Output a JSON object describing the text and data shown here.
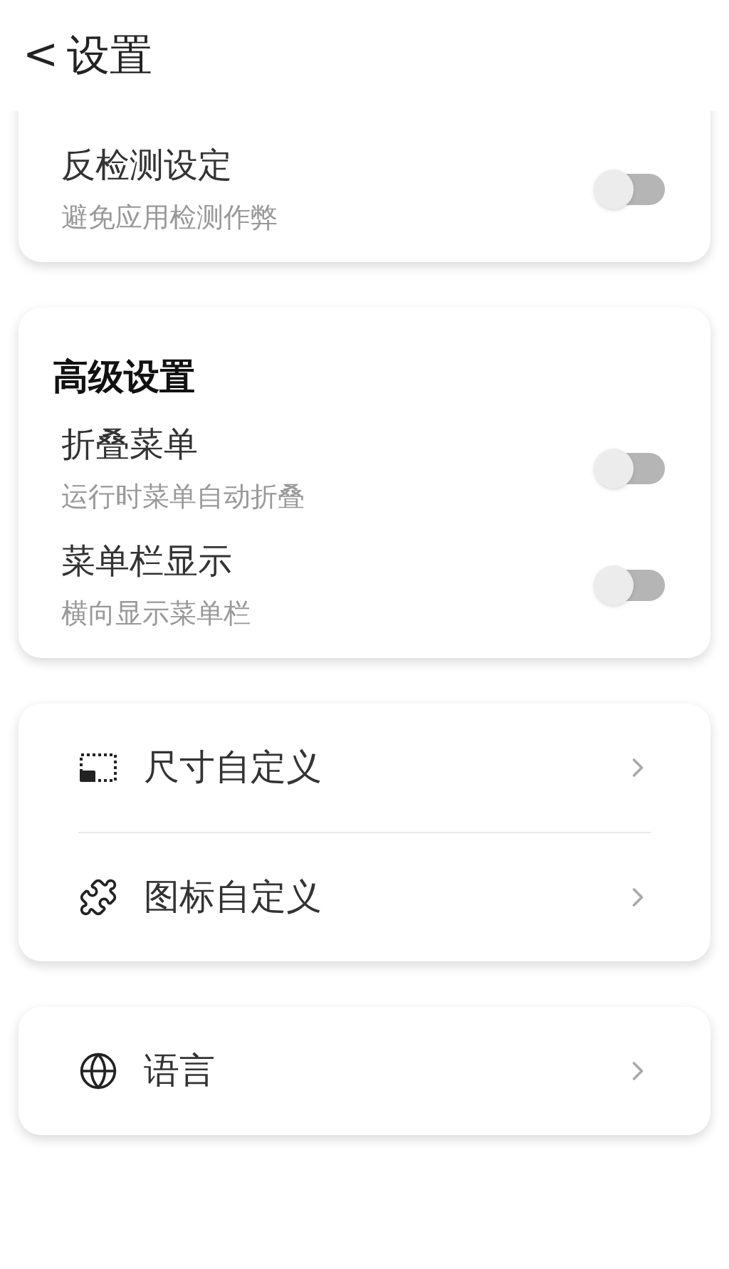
{
  "header": {
    "back": "<",
    "title": "设置"
  },
  "cards": [
    {
      "rows": [
        {
          "kind": "switch",
          "title": "反检测设定",
          "subtitle": "避免应用检测作弊",
          "on": false
        }
      ]
    },
    {
      "heading": "高级设置",
      "rows": [
        {
          "kind": "switch",
          "title": "折叠菜单",
          "subtitle": "运行时菜单自动折叠",
          "on": false
        },
        {
          "kind": "switch",
          "title": "菜单栏显示",
          "subtitle": "横向显示菜单栏",
          "on": false
        }
      ]
    },
    {
      "rows": [
        {
          "kind": "link",
          "title": "尺寸自定义"
        },
        {
          "kind": "link",
          "title": "图标自定义"
        }
      ]
    },
    {
      "rows": [
        {
          "kind": "link",
          "title": "语言"
        }
      ]
    }
  ]
}
